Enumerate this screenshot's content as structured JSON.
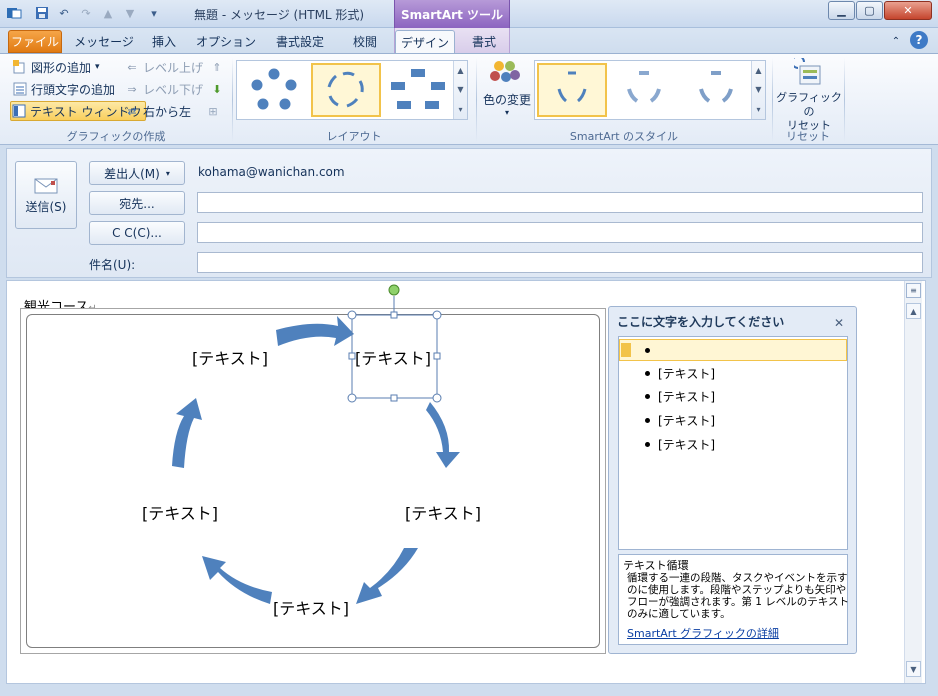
{
  "window": {
    "title": "無題 - メッセージ (HTML 形式)",
    "context_header": "SmartArt ツール"
  },
  "tabs": [
    "ファイル",
    "メッセージ",
    "挿入",
    "オプション",
    "書式設定",
    "校閲",
    "デザイン",
    "書式"
  ],
  "ribbon": {
    "create_graphic": {
      "add_shape": "図形の追加",
      "add_bullet": "行頭文字の追加",
      "text_pane": "テキスト ウィンドウ",
      "promote": "レベル上げ",
      "demote": "レベル下げ",
      "right_to_left": "右から左",
      "label": "グラフィックの作成"
    },
    "layouts": {
      "label": "レイアウト"
    },
    "styles": {
      "change_colors": "色の変更",
      "label": "SmartArt のスタイル"
    },
    "reset": {
      "reset_graphic_line1": "グラフィックの",
      "reset_graphic_line2": "リセット",
      "label": "リセット"
    }
  },
  "form": {
    "send": "送信(S)",
    "from_button": "差出人(M)",
    "from_value": "kohama@wanichan.com",
    "to_button": "宛先...",
    "cc_button": "C C(C)...",
    "subject_label": "件名(U):"
  },
  "body": {
    "heading": "観光コース",
    "nodes": [
      "[テキスト]",
      "[テキスト]",
      "[テキスト]",
      "[テキスト]",
      "[テキスト]"
    ]
  },
  "text_pane": {
    "title": "ここに文字を入力してください",
    "items": [
      "",
      "[テキスト]",
      "[テキスト]",
      "[テキスト]",
      "[テキスト]"
    ],
    "desc_title": "テキスト循環",
    "desc_lines": [
      "循環する一連の段階、タスクやイベントを示す",
      "のに使用します。段階やステップよりも矢印や",
      "フローが強調されます。第 1 レベルのテキスト",
      "のみに適しています。"
    ],
    "desc_link": "SmartArt グラフィックの詳細"
  },
  "colors": {
    "accent": "#4f81bd",
    "file_tab": "#e8861c",
    "context": "#9b74cc"
  }
}
